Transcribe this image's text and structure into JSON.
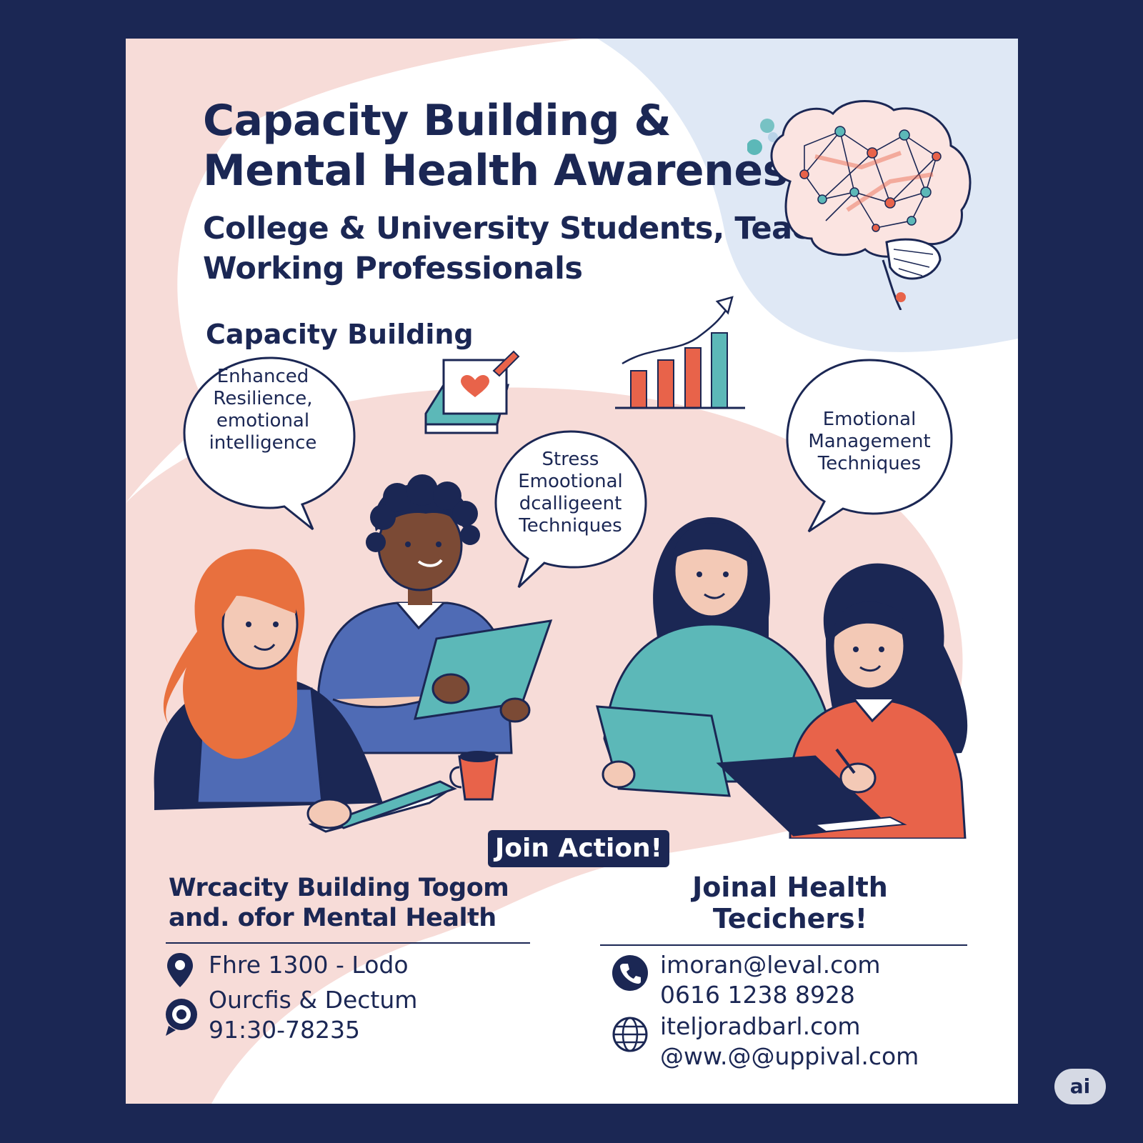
{
  "poster": {
    "title_line1": "Capacity Building &",
    "title_line2": "Mental Health Awareness",
    "audience_line1": "College & University Students, Teachers",
    "audience_line2": "Working Professionals",
    "section_heading": "Capacity Building"
  },
  "bubbles": [
    {
      "lines": [
        "Enhanced",
        "Resilience,",
        "emotional",
        "intelligence"
      ]
    },
    {
      "lines": [
        "Stress",
        "Emootional",
        "dcalligeent",
        "Techniques"
      ]
    },
    {
      "lines": [
        "Emotional",
        "Management",
        "Techniques"
      ]
    }
  ],
  "cta": {
    "label": "Join Action!"
  },
  "bottom_left": {
    "title_line1": "Wrcacity Building Togom",
    "title_line2": "and. ofor Mental Health",
    "location": "Fhre 1300 - Lodo",
    "contact_line1": "Ourcfis & Dectum",
    "contact_line2": "91:30-78235"
  },
  "bottom_right": {
    "title_line1": "Joinal Health",
    "title_line2": "Tecichers!",
    "email": "imoran@leval.com",
    "phone": "0616 1238 8928",
    "web_line1": "iteljoradbarl.com",
    "web_line2": "@ww.@@uppival.com"
  },
  "badge": {
    "label": "ai"
  },
  "icons": [
    "brain-icon",
    "book-heart-icon",
    "growth-chart-icon",
    "location-pin-icon",
    "location-chat-icon",
    "phone-icon",
    "globe-icon"
  ],
  "colors": {
    "navy": "#1b2754",
    "pink": "#f7dcd8",
    "blue": "#dfe8f5",
    "coral": "#e8634a",
    "teal": "#5cb8b8",
    "periwinkle": "#4f6bb5"
  }
}
